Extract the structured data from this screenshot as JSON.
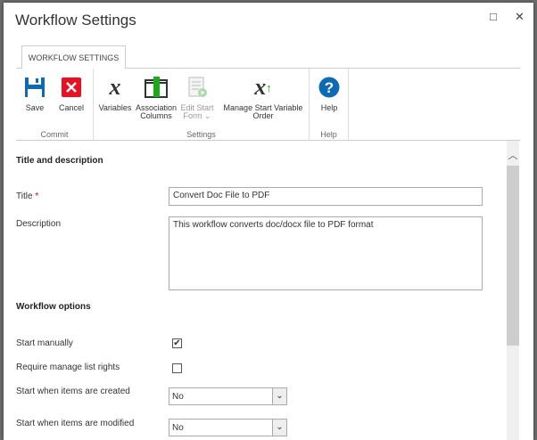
{
  "window": {
    "title": "Workflow Settings",
    "maximize_icon": "□",
    "close_icon": "✕"
  },
  "ribbon": {
    "tab": "WORKFLOW SETTINGS",
    "groups": {
      "commit": "Commit",
      "settings": "Settings",
      "help": "Help"
    },
    "buttons": {
      "save": "Save",
      "cancel": "Cancel",
      "variables": "Variables",
      "association_columns": "Association Columns",
      "edit_start_form": "Edit Start Form ⌄",
      "manage_start_variable_order": "Manage Start Variable Order",
      "help": "Help"
    }
  },
  "form": {
    "section_title": "Title and description",
    "title_label": "Title",
    "required_mark": "*",
    "title_value": "Convert Doc File to PDF",
    "description_label": "Description",
    "description_value": "This workflow converts doc/docx file to PDF format",
    "options_title": "Workflow options",
    "start_manually": "Start manually",
    "start_manually_checked": true,
    "require_manage": "Require manage list rights",
    "require_manage_checked": false,
    "start_created": "Start when items are created",
    "start_created_value": "No",
    "start_modified": "Start when items are modified",
    "start_modified_value": "No"
  },
  "colors": {
    "save": "#0f6ab4",
    "cancel": "#e81123",
    "help": "#0f6ab4",
    "green": "#1aaa1a"
  }
}
